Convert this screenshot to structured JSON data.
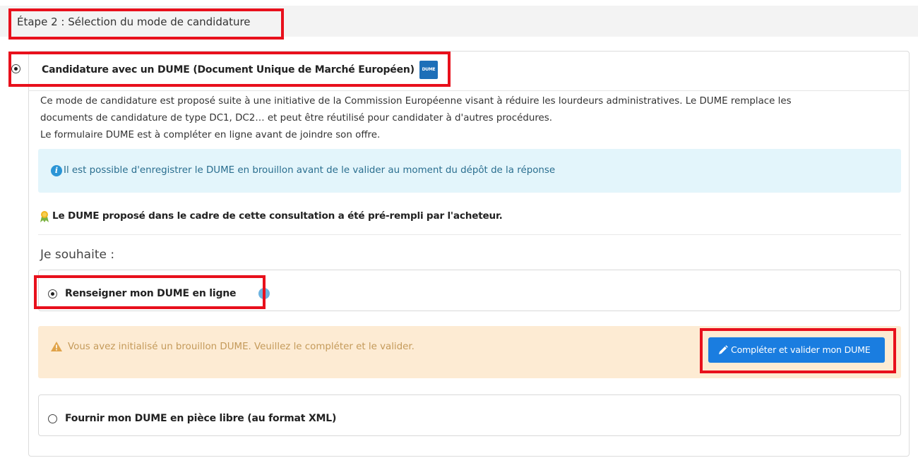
{
  "step": {
    "title": "Étape 2 : Sélection du mode de candidature"
  },
  "dume_option": {
    "title": "Candidature avec un DUME (Document Unique de Marché Européen)",
    "logo_text": "DUME",
    "selected": true,
    "description": [
      "Ce mode de candidature est proposé suite à une initiative de la Commission Européenne visant à réduire les lourdeurs administratives. Le DUME remplace les",
      "documents de candidature de type DC1, DC2… et peut être réutilisé pour candidater à d'autres procédures.",
      "Le formulaire DUME est à compléter en ligne avant de joindre son offre."
    ],
    "info": {
      "icon": "info-icon",
      "text": "Il est possible d'enregistrer le DUME en brouillon avant de le valider au moment du dépôt de la réponse"
    },
    "prefill": {
      "icon": "medal-icon",
      "text": "Le DUME proposé dans le cadre de cette consultation a été pré-rempli par l'acheteur."
    },
    "wish_label": "Je souhaite :",
    "online_option": {
      "label": "Renseigner mon DUME en ligne",
      "selected": true,
      "icon": "info-icon"
    },
    "warning": {
      "icon": "warning-icon",
      "text": "Vous avez initialisé un brouillon DUME. Veuillez le compléter et le valider."
    },
    "complete_button": {
      "icon": "pencil-icon",
      "label": "Compléter et valider mon DUME"
    },
    "xml_option": {
      "label": "Fournir mon DUME en pièce libre (au format XML)",
      "selected": false
    }
  },
  "colors": {
    "primary_button": "#1a7de0",
    "info_bg": "#e3f5fb",
    "warning_bg": "#fdebd3",
    "annotation_red": "#e8101c"
  }
}
